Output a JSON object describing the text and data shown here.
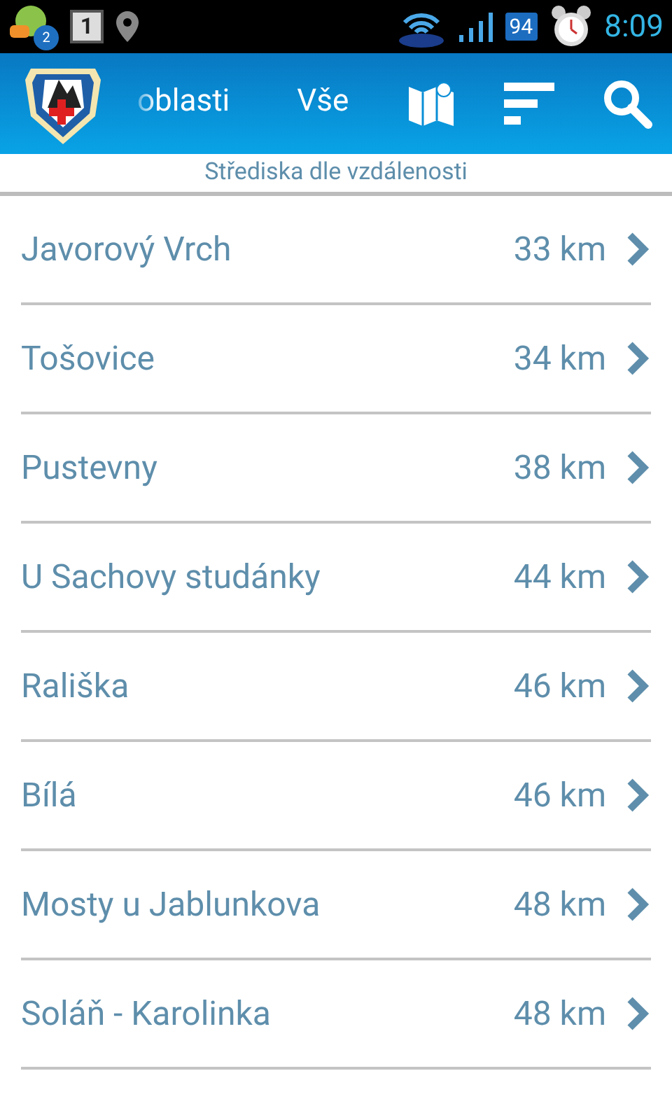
{
  "status_bar": {
    "chat_badge": "2",
    "calendar_day": "1",
    "battery": "94",
    "time": "8:09"
  },
  "action_bar": {
    "tabs": [
      {
        "label": "oblasti",
        "selected": false
      },
      {
        "label": "Vše",
        "selected": false
      }
    ]
  },
  "subtitle": "Střediska dle vzdálenosti",
  "list": [
    {
      "name": "Javorový Vrch",
      "distance": "33 km"
    },
    {
      "name": "Tošovice",
      "distance": "34 km"
    },
    {
      "name": "Pustevny",
      "distance": "38 km"
    },
    {
      "name": "U Sachovy studánky",
      "distance": "44 km"
    },
    {
      "name": "Rališka",
      "distance": "46 km"
    },
    {
      "name": "Bílá",
      "distance": "46 km"
    },
    {
      "name": "Mosty u Jablunkova",
      "distance": "48 km"
    },
    {
      "name": "Soláň - Karolinka",
      "distance": "48 km"
    }
  ]
}
